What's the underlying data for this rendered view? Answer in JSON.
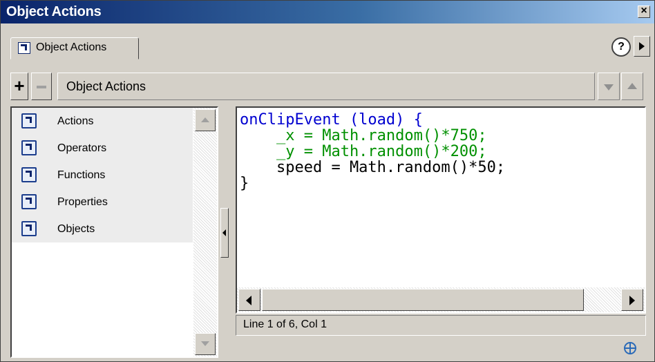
{
  "window": {
    "title": "Object Actions",
    "close_label": "×"
  },
  "tabs": [
    {
      "label": "Object Actions"
    }
  ],
  "help_label": "?",
  "toolbar": {
    "add_label": "+",
    "title": "Object Actions"
  },
  "toolbox": {
    "items": [
      {
        "label": "Actions",
        "icon": "book-icon"
      },
      {
        "label": "Operators",
        "icon": "book-icon"
      },
      {
        "label": "Functions",
        "icon": "book-icon"
      },
      {
        "label": "Properties",
        "icon": "book-icon"
      },
      {
        "label": "Objects",
        "icon": "book-icon"
      }
    ]
  },
  "editor": {
    "lines": [
      "onClipEvent (load) {",
      "    _x = Math.random()*750;",
      "    _y = Math.random()*200;",
      "    speed = Math.random()*50;",
      "}"
    ]
  },
  "status": {
    "text": "Line 1 of 6, Col 1"
  },
  "colors": {
    "keyword": "#0000d0",
    "property": "#009000",
    "title_bar_start": "#0a246a",
    "title_bar_end": "#a6caf0"
  }
}
